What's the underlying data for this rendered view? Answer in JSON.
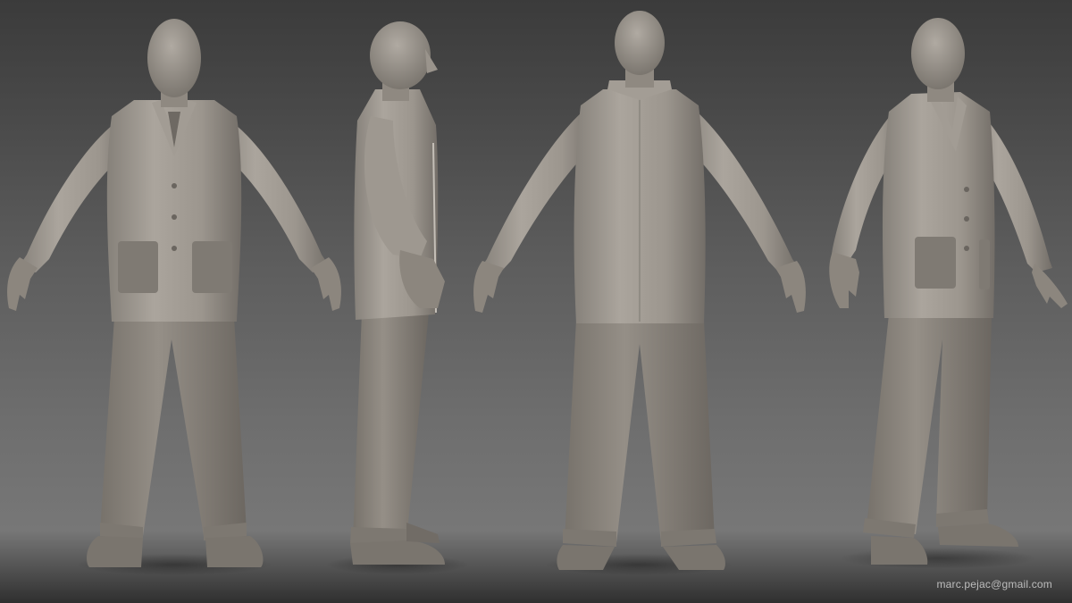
{
  "credit": {
    "email": "marc.pejac@gmail.com"
  },
  "render": {
    "background_top": "#3b3b3b",
    "background_bottom": "#777777",
    "clay_light": "#aaa49c",
    "clay_mid": "#948e86",
    "clay_dark": "#6f6a64",
    "pocket": "#7f7a73"
  },
  "views": [
    {
      "name": "front"
    },
    {
      "name": "side"
    },
    {
      "name": "back"
    },
    {
      "name": "three-quarter"
    }
  ]
}
